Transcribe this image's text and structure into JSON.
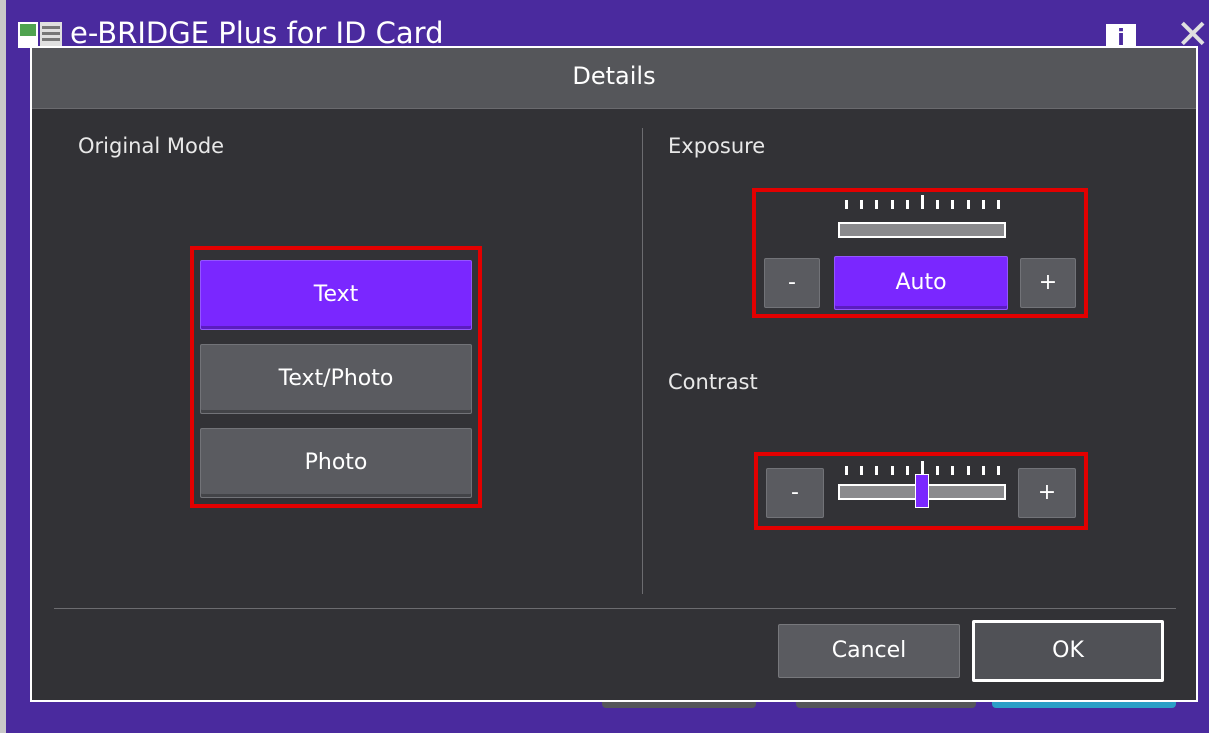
{
  "app": {
    "title": "e-BRIDGE Plus for ID Card",
    "info_icon": "info-icon",
    "info_glyph": "i",
    "close_icon": "close-icon",
    "close_glyph": "✕",
    "accent_color": "#4a2a9e"
  },
  "dialog": {
    "title": "Details",
    "original_mode": {
      "label": "Original Mode",
      "options": [
        {
          "label": "Text",
          "selected": true
        },
        {
          "label": "Text/Photo",
          "selected": false
        },
        {
          "label": "Photo",
          "selected": false
        }
      ]
    },
    "exposure": {
      "label": "Exposure",
      "minus_label": "-",
      "plus_label": "+",
      "auto_label": "Auto",
      "auto_selected": true
    },
    "contrast": {
      "label": "Contrast",
      "minus_label": "-",
      "plus_label": "+",
      "level": 0.5
    },
    "footer": {
      "cancel_label": "Cancel",
      "ok_label": "OK"
    }
  },
  "colors": {
    "selected": "#7a27ff",
    "highlight": "#e30000",
    "dialog_bg": "#323236"
  }
}
